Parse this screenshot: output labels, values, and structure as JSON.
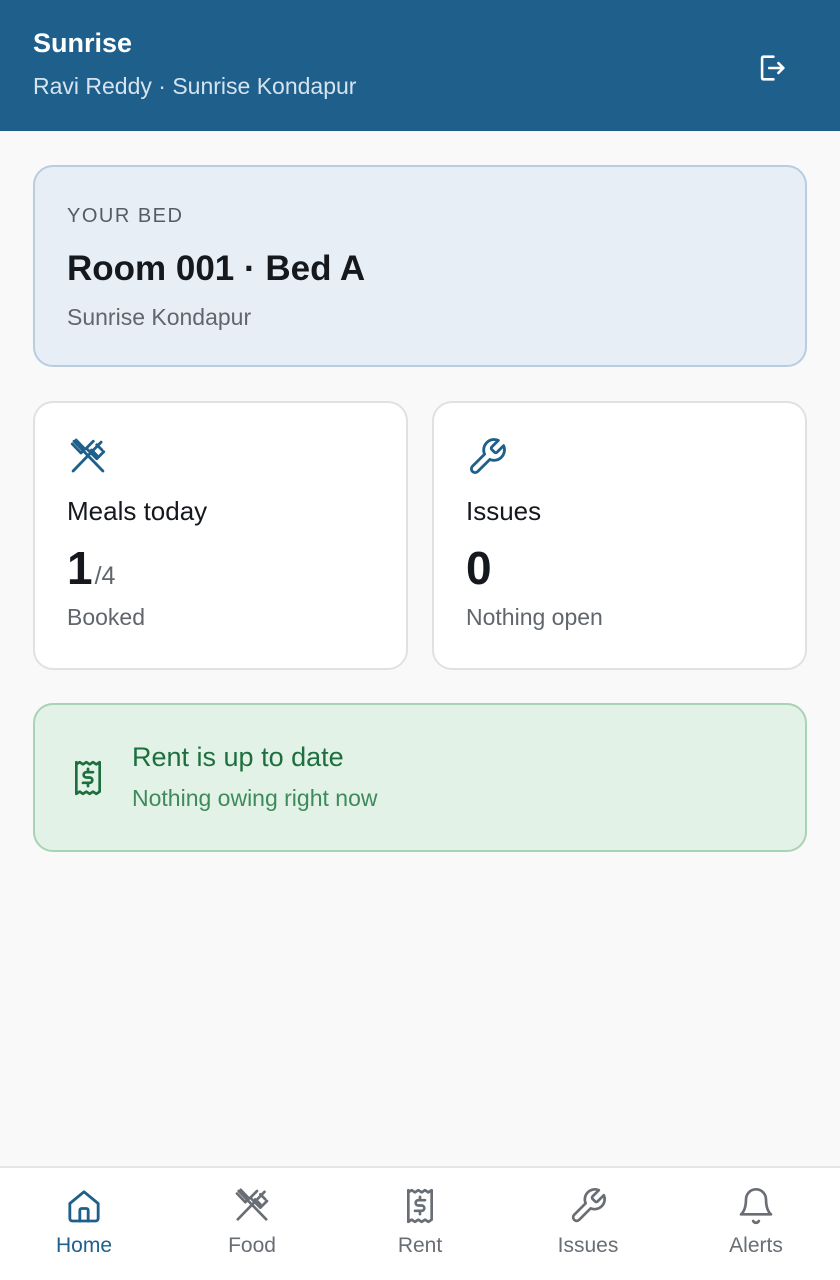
{
  "header": {
    "title": "Sunrise",
    "subtitle": "Ravi Reddy · Sunrise Kondapur",
    "logout_icon": "logout-icon"
  },
  "bed": {
    "label": "YOUR BED",
    "room": "Room 001 · Bed A",
    "location": "Sunrise Kondapur"
  },
  "meals": {
    "icon": "utensils-icon",
    "title": "Meals today",
    "booked": "1",
    "total": "/4",
    "caption": "Booked"
  },
  "issues": {
    "icon": "wrench-icon",
    "title": "Issues",
    "count": "0",
    "caption": "Nothing open"
  },
  "rent": {
    "icon": "receipt-icon",
    "title": "Rent is up to date",
    "caption": "Nothing owing right now"
  },
  "nav": {
    "items": [
      {
        "label": "Home",
        "icon": "home-icon",
        "active": true
      },
      {
        "label": "Food",
        "icon": "utensils-icon",
        "active": false
      },
      {
        "label": "Rent",
        "icon": "receipt-icon",
        "active": false
      },
      {
        "label": "Issues",
        "icon": "wrench-icon",
        "active": false
      },
      {
        "label": "Alerts",
        "icon": "bell-icon",
        "active": false
      }
    ]
  },
  "colors": {
    "brand": "#1e5f8c",
    "success": "#1d6f3e",
    "success_bg": "#e2f2e6",
    "bed_bg": "#e8eef5"
  }
}
